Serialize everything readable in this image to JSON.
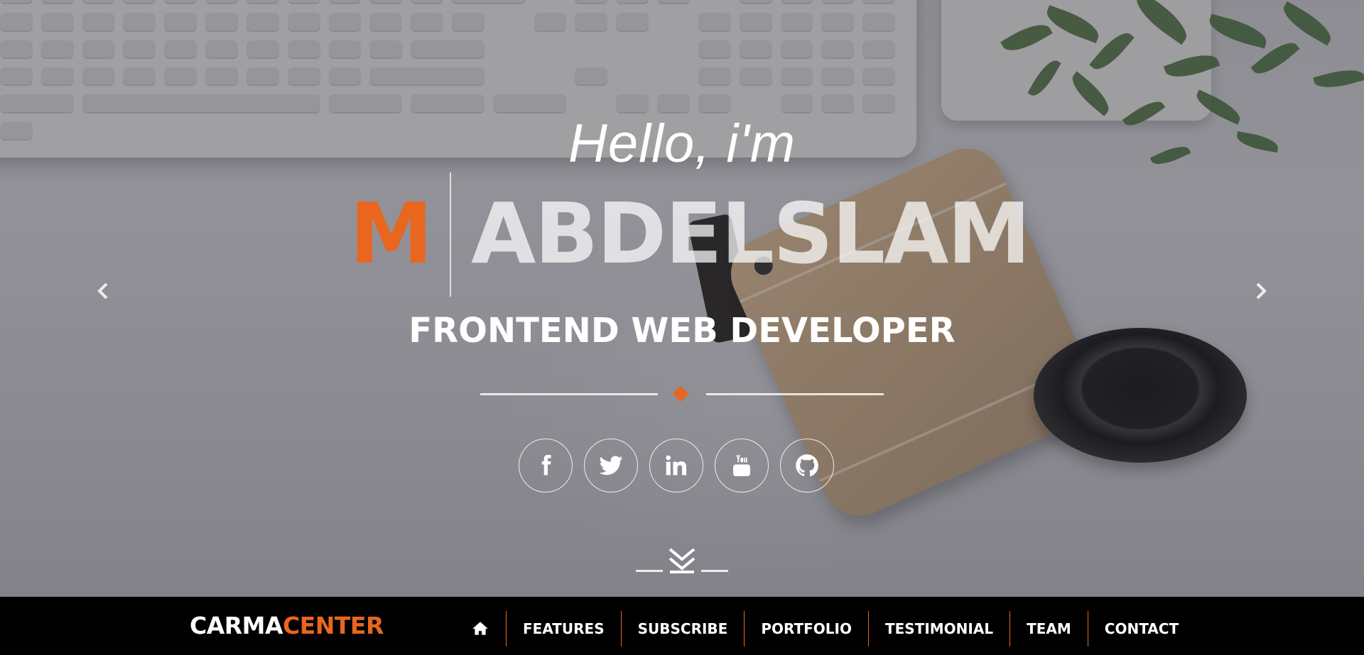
{
  "colors": {
    "accent": "#e9661f",
    "navbar_bg": "#000000",
    "text": "#ffffff"
  },
  "hero": {
    "greeting": "Hello, i'm",
    "initial": "M",
    "surname": "ABDELSLAM",
    "role": "FRONTEND WEB DEVELOPER",
    "socials": [
      {
        "name": "facebook",
        "icon": "facebook-icon"
      },
      {
        "name": "twitter",
        "icon": "twitter-icon"
      },
      {
        "name": "linkedin",
        "icon": "linkedin-icon"
      },
      {
        "name": "youtube",
        "icon": "youtube-icon",
        "glyph_text": "You Tube"
      },
      {
        "name": "github",
        "icon": "github-icon"
      }
    ],
    "prev_icon": "chevron-left-icon",
    "next_icon": "chevron-right-icon",
    "scroll_icon": "double-chevron-down-icon"
  },
  "navbar": {
    "brand_part1": "CARMA",
    "brand_part2": "CENTER",
    "home_icon": "home-icon",
    "items": [
      "FEATURES",
      "SUBSCRIBE",
      "PORTFOLIO",
      "TESTIMONIAL",
      "TEAM",
      "CONTACT"
    ]
  }
}
